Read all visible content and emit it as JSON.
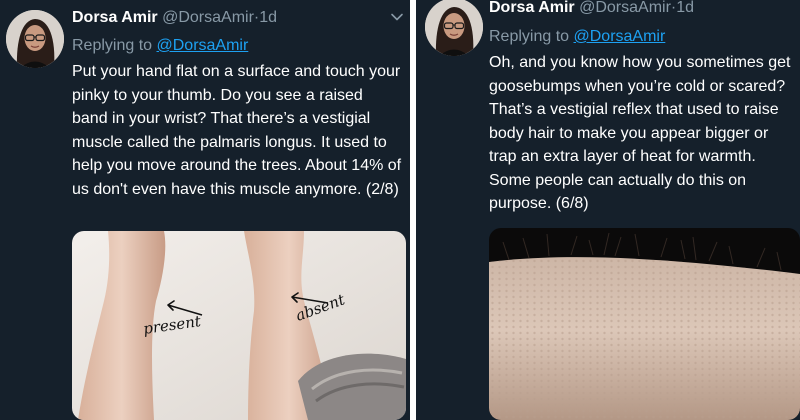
{
  "tweets": [
    {
      "author_name": "Dorsa Amir",
      "handle": "@DorsaAmir",
      "separator": "·",
      "time": "1d",
      "replying_prefix": "Replying to",
      "replying_to": "@DorsaAmir",
      "text": "Put your hand flat on a surface and touch your pinky to your thumb. Do you see a raised band in your wrist? That there’s a vestigial muscle called the palmaris longus. It used to help you move around the trees. About 14% of us don't even have this muscle anymore. (2/8)",
      "image_labels": {
        "present": "present",
        "absent": "absent"
      },
      "menu_icon": "chevron-down-icon"
    },
    {
      "author_name": "Dorsa Amir",
      "handle": "@DorsaAmir",
      "separator": "·",
      "time": "1d",
      "replying_prefix": "Replying to",
      "replying_to": "@DorsaAmir",
      "text": "Oh, and you know how you sometimes get goosebumps when you’re cold or scared? That’s a vestigial reflex that used to raise body hair to make you appear bigger or trap an extra layer of heat for warmth. Some people can actually do this on purpose. (6/8)"
    }
  ],
  "colors": {
    "background": "#15202b",
    "text": "#ffffff",
    "secondary": "#8899a6",
    "link": "#1da1f2"
  }
}
